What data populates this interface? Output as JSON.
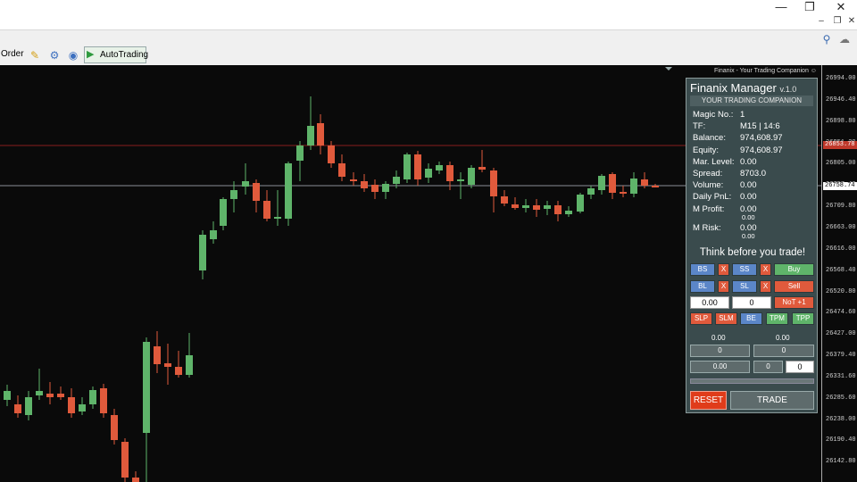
{
  "toolbar": {
    "order_label": "Order",
    "autotrading_label": "AutoTrading"
  },
  "chart": {
    "companion_text": "Finanix - Your Trading Companion",
    "price_axis": [
      "26994.00",
      "26946.40",
      "26898.80",
      "26851.20",
      "26805.00",
      "26757.40",
      "26709.80",
      "26663.00",
      "26616.00",
      "26568.40",
      "26520.80",
      "26474.60",
      "26427.00",
      "26379.40",
      "26331.60",
      "26285.60",
      "26238.00",
      "26190.40",
      "26142.80"
    ],
    "price_tags": [
      {
        "text": "26853.78",
        "color": "#c0392b",
        "fg": "#ffffff"
      },
      {
        "text": "26758.74",
        "color": "#ffffff",
        "fg": "#000000"
      }
    ],
    "colors": {
      "bull": "#5fb46a",
      "bear": "#e05a3c",
      "background": "#0a0a0a",
      "red_line": "#8a1e1e",
      "gray_line": "#8a8f96"
    }
  },
  "panel": {
    "title": "Finanix Manager",
    "version": "v.1.0",
    "subtitle": "YOUR TRADING COMPANION",
    "info": [
      {
        "label": "Magic No.:",
        "value": "1"
      },
      {
        "label": "TF:",
        "value": "M15 | 14:6"
      },
      {
        "label": "Balance:",
        "value": "974,608.97"
      },
      {
        "label": "Equity:",
        "value": "974,608.97"
      },
      {
        "label": "Mar. Level:",
        "value": "0.00"
      },
      {
        "label": "Spread:",
        "value": "8703.0"
      },
      {
        "label": "Volume:",
        "value": "0.00"
      },
      {
        "label": "Daily PnL:",
        "value": "0.00"
      },
      {
        "label": "M Profit:",
        "value": "0.00",
        "sub": "0.00"
      },
      {
        "label": "M Risk:",
        "value": "0.00",
        "sub": "0.00"
      }
    ],
    "motto": "Think before you trade!",
    "buttons": {
      "bs": "BS",
      "x1": "X",
      "ss": "SS",
      "x2": "X",
      "buy": "Buy",
      "bl": "BL",
      "x3": "X",
      "sl": "SL",
      "x4": "X",
      "sell": "Sell",
      "lot_value": "0.00",
      "count_value": "0",
      "not": "NoT +1",
      "slp": "SLP",
      "slm": "SLM",
      "be": "BE",
      "tpm": "TPM",
      "tpp": "TPP"
    },
    "values_row1": {
      "left": "0.00",
      "right": "0.00"
    },
    "values_row2": {
      "left": "0",
      "right": "0"
    },
    "values_row3": {
      "left": "0.00",
      "mid": "0",
      "right": "0"
    },
    "reset": "RESET",
    "trade": "TRADE"
  }
}
